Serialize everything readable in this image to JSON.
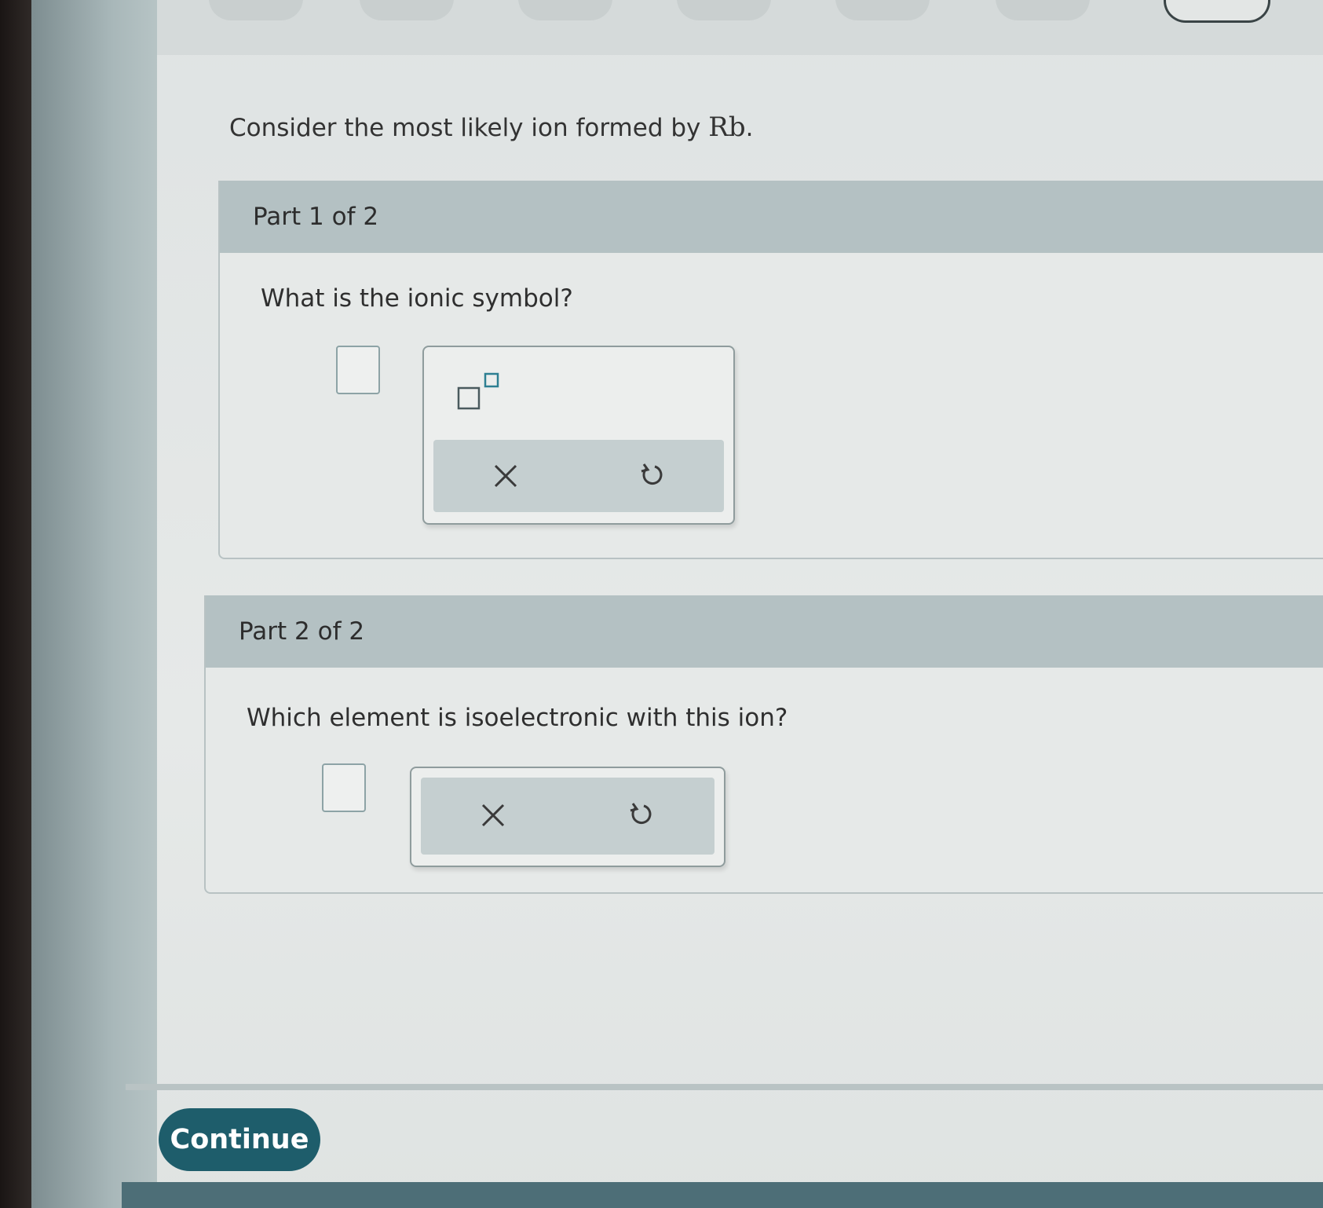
{
  "question": {
    "text": "Consider the most likely ion formed by ",
    "element": "Rb",
    "end": "."
  },
  "part1": {
    "header": "Part 1 of 2",
    "prompt": "What is the ionic symbol?",
    "clear_icon": "close-icon",
    "undo_icon": "undo-icon"
  },
  "part2": {
    "header": "Part 2 of 2",
    "prompt": "Which element is isoelectronic with this ion?",
    "clear_icon": "close-icon",
    "undo_icon": "undo-icon"
  },
  "continue_label": "Continue",
  "colors": {
    "accent": "#1e5d6b",
    "part_header": "#b4c1c3"
  }
}
